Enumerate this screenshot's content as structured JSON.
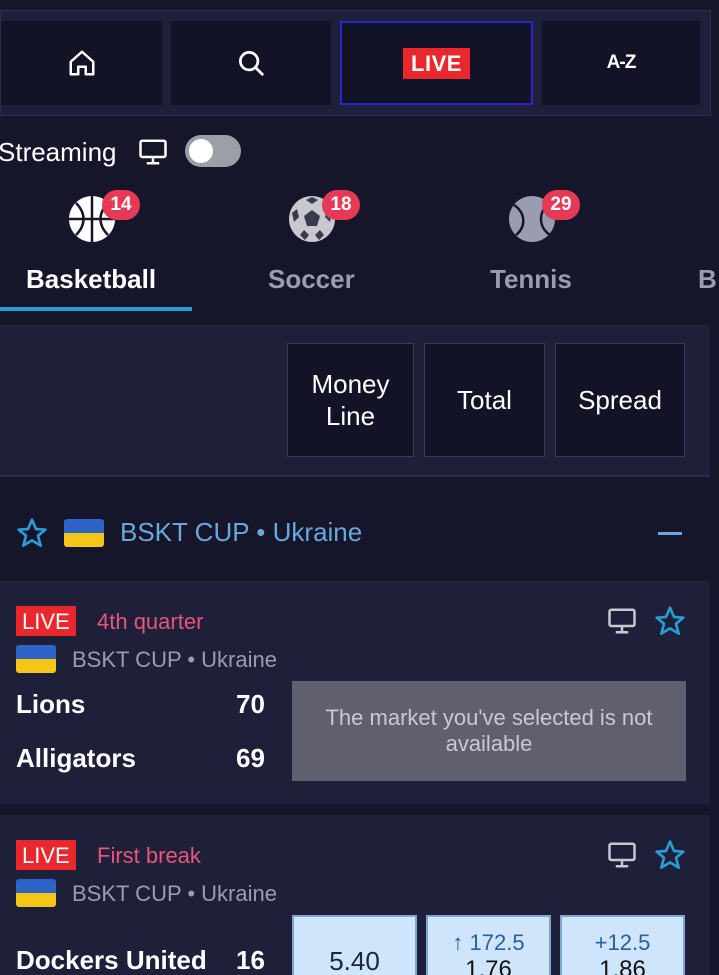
{
  "nav": {
    "live_label": "LIVE",
    "az_label": "A-Z",
    "icons": [
      "home-icon",
      "search-icon"
    ]
  },
  "streaming": {
    "label": "Streaming",
    "toggle_on": false
  },
  "sports": [
    {
      "label": "Basketball",
      "count": "14",
      "icon": "basketball-icon",
      "active": true
    },
    {
      "label": "Soccer",
      "count": "18",
      "icon": "soccer-ball-icon",
      "active": false
    },
    {
      "label": "Tennis",
      "count": "29",
      "icon": "tennis-ball-icon",
      "active": false
    },
    {
      "label": "B",
      "count": "",
      "icon": "",
      "active": false
    }
  ],
  "markets": [
    {
      "label_line1": "Money",
      "label_line2": "Line"
    },
    {
      "label": "Total"
    },
    {
      "label": "Spread"
    }
  ],
  "league": {
    "title": "BSKT CUP • Ukraine"
  },
  "events": [
    {
      "live": "LIVE",
      "status": "4th quarter",
      "league": "BSKT CUP • Ukraine",
      "home": "Lions",
      "home_score": "70",
      "away": "Alligators",
      "away_score": "69",
      "message": "The market you've selected is not available"
    },
    {
      "live": "LIVE",
      "status": "First break",
      "league": "BSKT CUP • Ukraine",
      "home": "Dockers United",
      "home_score": "16",
      "odds": {
        "money_line": "5.40",
        "total_line": "↑ 172.5",
        "total_odd": "1.76",
        "spread_line": "+12.5",
        "spread_odd": "1.86"
      }
    }
  ],
  "colors": {
    "background": "#15162a",
    "panel": "#1e1f38",
    "live_red": "#e8282c",
    "accent_blue": "#2b9bd6",
    "league_blue": "#6aa6dc",
    "status_pink": "#e8557a",
    "badge_red": "#e63956"
  }
}
